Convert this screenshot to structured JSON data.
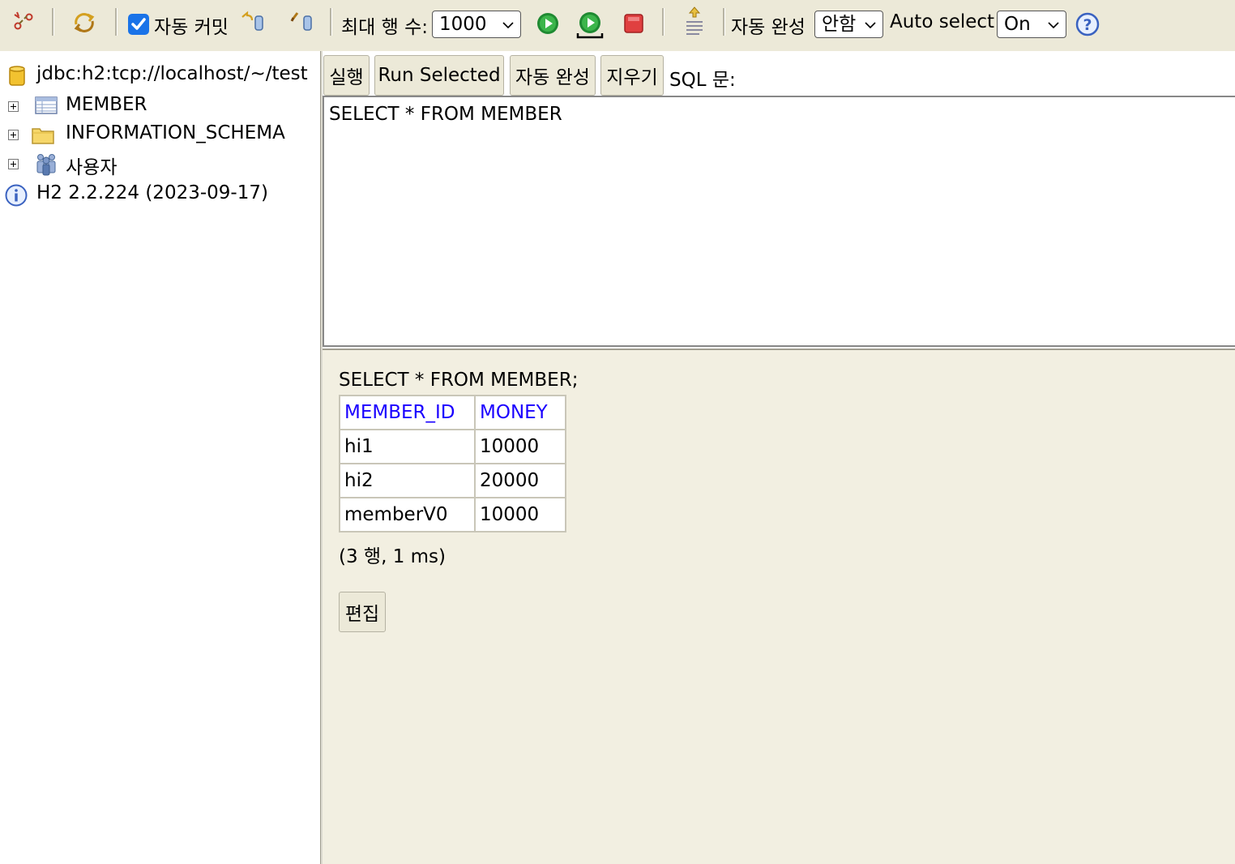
{
  "toolbar": {
    "disconnect_icon": "disconnect-icon",
    "refresh_icon": "refresh-icon",
    "autocommit_checked": true,
    "autocommit_label": "자동 커밋",
    "rollback_icon": "rollback-icon",
    "commit_icon": "commit-icon",
    "max_rows_label": "최대 행 수:",
    "max_rows_value": "1000",
    "run_icon": "run-icon",
    "run_selected_icon": "run-selected-icon",
    "stop_icon": "stop-icon",
    "history_icon": "history-icon",
    "autocomplete_label": "자동 완성",
    "autocomplete_value": "안함",
    "autoselect_label": "Auto select",
    "autoselect_value": "On",
    "help_icon": "help-icon"
  },
  "tree": {
    "connection": "jdbc:h2:tcp://localhost/~/test",
    "items": [
      {
        "label": "MEMBER",
        "icon": "table-icon"
      },
      {
        "label": "INFORMATION_SCHEMA",
        "icon": "folder-icon"
      },
      {
        "label": "사용자",
        "icon": "users-icon"
      }
    ],
    "version": "H2 2.2.224 (2023-09-17)"
  },
  "sqlbar": {
    "run_label": "실행",
    "run_selected_label": "Run Selected",
    "autocomplete_label": "자동 완성",
    "clear_label": "지우기",
    "sql_label": "SQL 문:"
  },
  "editor": {
    "text": "SELECT * FROM MEMBER"
  },
  "result": {
    "query": "SELECT * FROM MEMBER;",
    "columns": [
      "MEMBER_ID",
      "MONEY"
    ],
    "rows": [
      [
        "hi1",
        "10000"
      ],
      [
        "hi2",
        "20000"
      ],
      [
        "memberV0",
        "10000"
      ]
    ],
    "row_count": "(3 행, 1 ms)",
    "edit_label": "편집"
  }
}
